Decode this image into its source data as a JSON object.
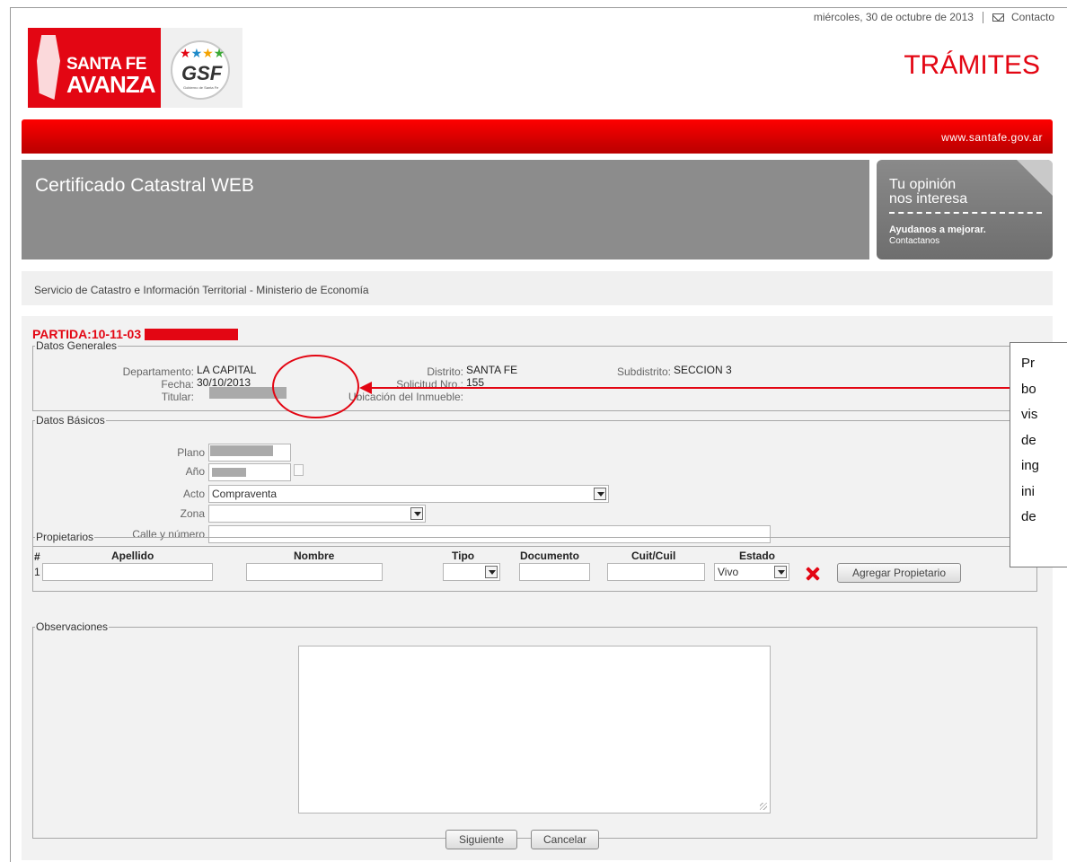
{
  "header": {
    "date": "miércoles, 30 de octubre de 2013",
    "contact_label": "Contacto",
    "logo_line1": "SANTA FE",
    "logo_line2": "AVANZA",
    "gsf_label": "GSF",
    "gsf_sub": "Gobierno de Santa Fe",
    "tramites": "TRÁMITES",
    "site_url": "www.santafe.gov.ar"
  },
  "banner": {
    "title": "Certificado Catastral WEB",
    "opinion_line1": "Tu opinión",
    "opinion_line2": "nos interesa",
    "opinion_cta": "Ayudanos a mejorar.",
    "opinion_link": "Contactanos"
  },
  "service_title": "Servicio de Catastro e Información Territorial - Ministerio de Economía",
  "partida": "PARTIDA:10-11-03",
  "datos_generales": {
    "legend": "Datos Generales",
    "departamento_label": "Departamento:",
    "departamento_value": "LA CAPITAL",
    "distrito_label": "Distrito:",
    "distrito_value": "SANTA FE",
    "subdistrito_label": "Subdistrito:",
    "subdistrito_value": "SECCION 3",
    "fecha_label": "Fecha:",
    "fecha_value": "30/10/2013",
    "solicitud_label": "Solicitud Nro.:",
    "solicitud_value": "155",
    "titular_label": "Titular:",
    "ubicacion_label": "Ubicación del Inmueble:"
  },
  "datos_basicos": {
    "legend": "Datos Básicos",
    "plano_label": "Plano",
    "anio_label": "Año",
    "acto_label": "Acto",
    "acto_value": "Compraventa",
    "zona_label": "Zona",
    "zona_value": "",
    "calle_label": "Calle y número",
    "calle_value": ""
  },
  "propietarios": {
    "legend": "Propietarios",
    "col_num": "#",
    "col_apellido": "Apellido",
    "col_nombre": "Nombre",
    "col_tipo": "Tipo",
    "col_documento": "Documento",
    "col_cuit": "Cuit/Cuil",
    "col_estado": "Estado",
    "row_num": "1",
    "estado_value": "Vivo",
    "add_button": "Agregar Propietario"
  },
  "observaciones": {
    "legend": "Observaciones"
  },
  "buttons": {
    "siguiente": "Siguiente",
    "cancelar": "Cancelar"
  },
  "callout_lines": [
    "Pr",
    "bo",
    "vis",
    "de",
    "ing",
    "ini",
    "de"
  ],
  "colors": {
    "brand_red": "#e30613",
    "banner_gray": "#8c8c8c"
  }
}
